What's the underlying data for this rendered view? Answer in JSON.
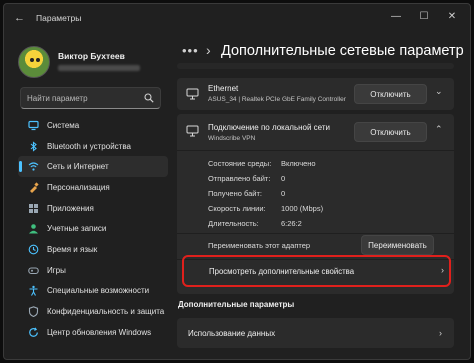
{
  "window": {
    "back_glyph": "←",
    "title": "Параметры",
    "controls": {
      "minimize": "—",
      "maximize": "☐",
      "close": "✕"
    }
  },
  "profile": {
    "name": "Виктор Бухтеев"
  },
  "search": {
    "placeholder": "Найти параметр",
    "value": ""
  },
  "sidebar": {
    "items": [
      {
        "label": "Система",
        "icon": "monitor-icon",
        "color": "#4cc2ff"
      },
      {
        "label": "Bluetooth и устройства",
        "icon": "bluetooth-icon",
        "color": "#4cc2ff"
      },
      {
        "label": "Сеть и Интернет",
        "icon": "network-icon",
        "color": "#4cc2ff",
        "active": true
      },
      {
        "label": "Персонализация",
        "icon": "brush-icon",
        "color": "#e8a44c"
      },
      {
        "label": "Приложения",
        "icon": "apps-icon",
        "color": "#9aa7b3"
      },
      {
        "label": "Учетные записи",
        "icon": "account-icon",
        "color": "#3fbf7f"
      },
      {
        "label": "Время и язык",
        "icon": "globe-clock-icon",
        "color": "#4cc2ff"
      },
      {
        "label": "Игры",
        "icon": "gamepad-icon",
        "color": "#9aa7b3"
      },
      {
        "label": "Специальные возможности",
        "icon": "accessibility-icon",
        "color": "#4cc2ff"
      },
      {
        "label": "Конфиденциальность и защита",
        "icon": "shield-icon",
        "color": "#9aa7b3"
      },
      {
        "label": "Центр обновления Windows",
        "icon": "update-icon",
        "color": "#4cc2ff"
      }
    ]
  },
  "main": {
    "breadcrumb_dots": "•••",
    "breadcrumb_chevron": "›",
    "title": "Дополнительные сетевые параметр",
    "ethernet": {
      "title": "Ethernet",
      "subtitle": "ASUS_34 | Realtek PCIe GbE Family Controller",
      "button": "Отключить",
      "chevron": "⌄"
    },
    "lan": {
      "title": "Подключение по локальной сети",
      "subtitle": "Windscribe VPN",
      "button": "Отключить",
      "chevron": "⌃",
      "properties": [
        {
          "label": "Состояние среды:",
          "value": "Включено"
        },
        {
          "label": "Отправлено байт:",
          "value": "0"
        },
        {
          "label": "Получено байт:",
          "value": "0"
        },
        {
          "label": "Скорость линии:",
          "value": "1000 (Mbps)"
        },
        {
          "label": "Длительность:",
          "value": "6:26:2"
        }
      ],
      "rename_label": "Переименовать этот адаптер",
      "rename_button": "Переименовать",
      "advanced_label": "Просмотреть дополнительные свойства",
      "advanced_chevron": "›"
    },
    "section_header": "Дополнительные параметры",
    "data_usage": {
      "label": "Использование данных",
      "chevron": "›"
    }
  },
  "colors": {
    "accent": "#4cc2ff",
    "highlight": "#e0201c"
  }
}
